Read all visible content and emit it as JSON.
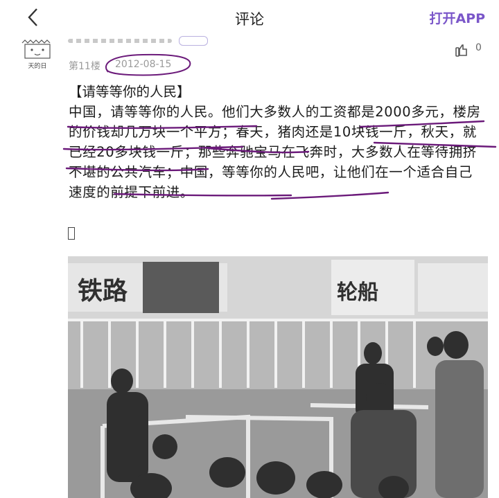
{
  "header": {
    "title": "评论",
    "open_app": "打开APP"
  },
  "comment": {
    "avatar_text": "天的日",
    "floor": "第11楼",
    "date": "2012-08-15",
    "like_count": "0",
    "title": "【请等等你的人民】",
    "body": "中国，请等等你的人民。他们大多数人的工资都是2000多元，楼房的价钱却几万块一个平方；春天，猪肉还是10块钱一斤，秋天，就已经20多块钱一斤；那些奔驰宝马在飞奔时，大多数人在等待拥挤不堪的公共汽车；中国，等等你的人民吧，让他们在一个适合自己速度的前提下前进。"
  },
  "photo": {
    "sign_left": "铁路",
    "sign_right": "轮船"
  },
  "colors": {
    "accent": "#7a56c9",
    "ink": "#6b1a7a",
    "meta": "#9a9a9a"
  }
}
